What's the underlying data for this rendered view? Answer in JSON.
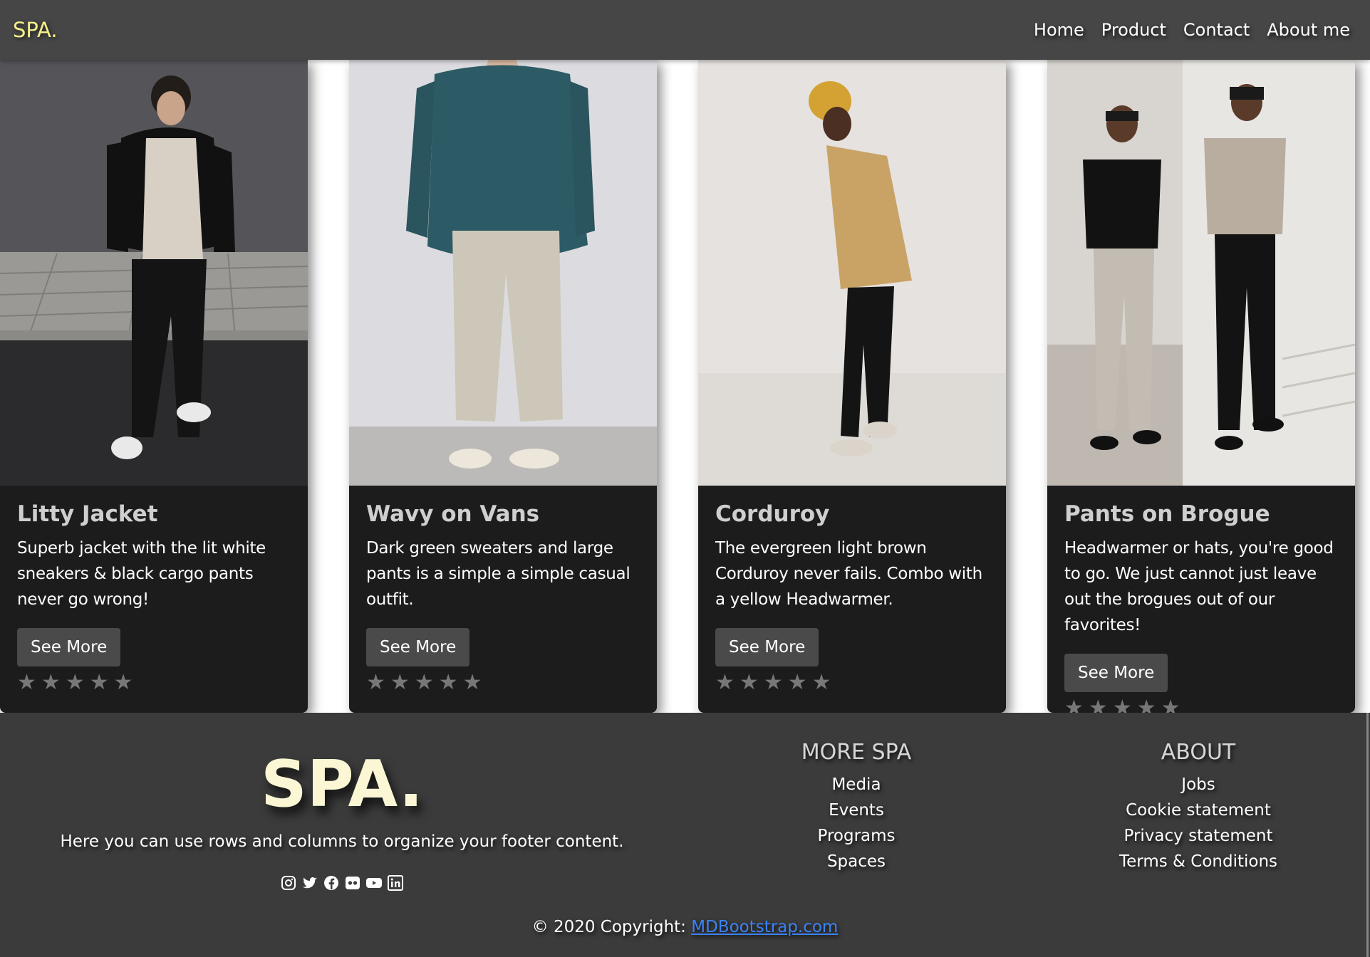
{
  "navbar": {
    "brand": "SPA.",
    "links": [
      "Home",
      "Product",
      "Contact",
      "About me"
    ]
  },
  "cards": [
    {
      "title": "Litty Jacket",
      "text": "Superb jacket with the lit white sneakers & black cargo pants never go wrong!",
      "button": "See More",
      "image": "man in black puffer jacket, cream sweater, black cargo pants and white sneakers on pavement"
    },
    {
      "title": "Wavy on Vans",
      "text": "Dark green sweaters and large pants is a simple a simple casual outfit.",
      "button": "See More",
      "image": "man in dark teal sweater, beige wide pants and cream Vans sneakers"
    },
    {
      "title": "Corduroy",
      "text": "The evergreen light brown Corduroy never fails. Combo with a yellow Headwarmer.",
      "button": "See More",
      "image": "man in mustard beanie, light brown corduroy jacket and black pants"
    },
    {
      "title": "Pants on Brogue",
      "text": "Headwarmer or hats, you're good to go. We just cannot just leave out the brogues out of our favorites!",
      "button": "See More",
      "image": "two men in shirts, tailored pants and black brogues near staircase"
    }
  ],
  "footer": {
    "brand": "SPA.",
    "description": "Here you can use rows and columns to organize your footer content.",
    "socials": [
      "instagram-icon",
      "twitter-icon",
      "facebook-icon",
      "flickr-icon",
      "youtube-icon",
      "linkedin-icon"
    ],
    "more_spa": {
      "heading": "MORE SPA",
      "links": [
        "Media",
        "Events",
        "Programs",
        "Spaces"
      ]
    },
    "about": {
      "heading": "ABOUT",
      "links": [
        "Jobs",
        "Cookie statement",
        "Privacy statement",
        "Terms & Conditions"
      ]
    },
    "copyright_prefix": "© 2020 Copyright: ",
    "copyright_link": "MDBootstrap.com"
  },
  "colors": {
    "navbar_bg": "#464646",
    "brand": "#f6f08a",
    "card_bg": "#1c1c1c",
    "button_bg": "#4a4a4a",
    "footer_bg": "#3b3b3b",
    "link": "#3b82f6"
  },
  "rating": {
    "value": 0,
    "max": 5
  }
}
